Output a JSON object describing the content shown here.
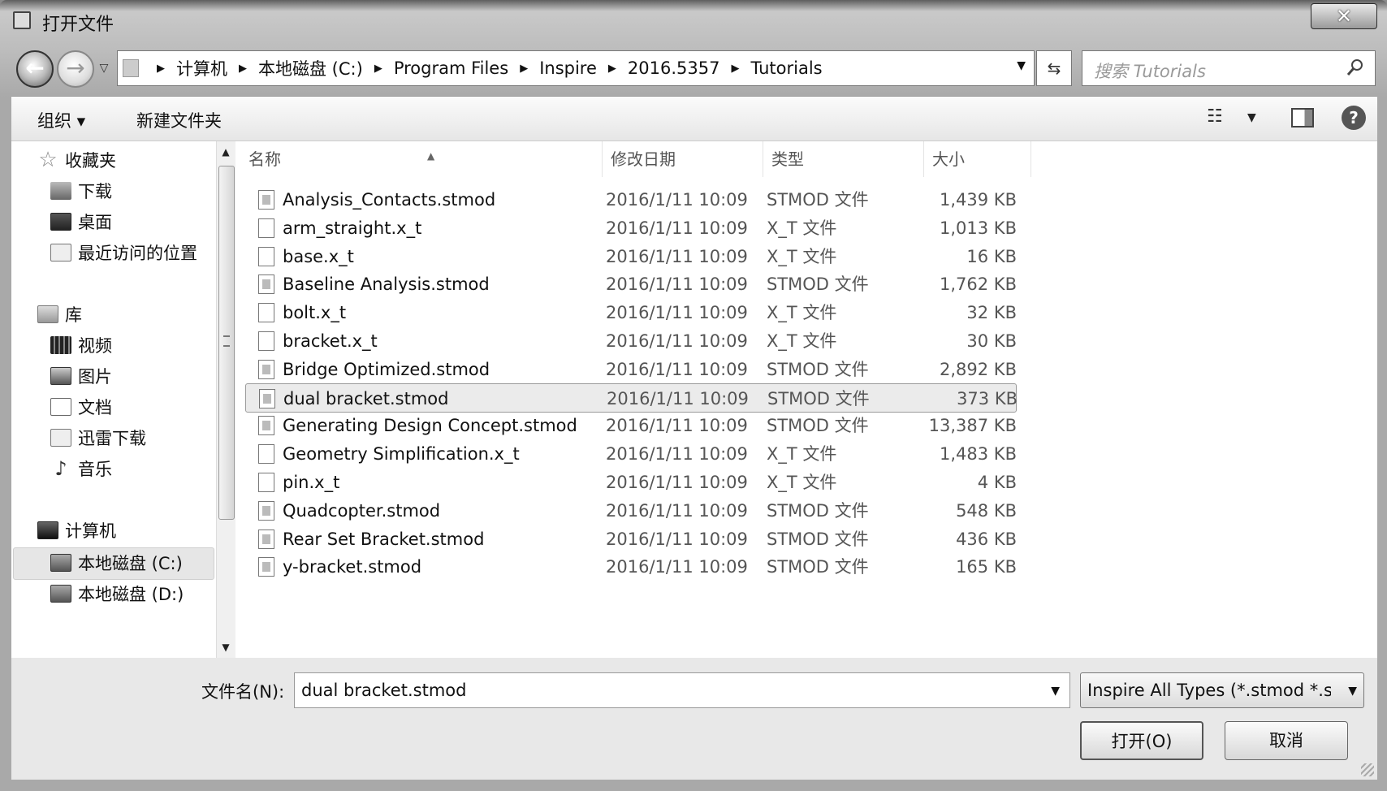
{
  "window": {
    "title": "打开文件",
    "close_glyph": "✕"
  },
  "nav": {
    "breadcrumbs": [
      "计算机",
      "本地磁盘 (C:)",
      "Program Files",
      "Inspire",
      "2016.5357",
      "Tutorials"
    ],
    "search_placeholder": "搜索 Tutorials"
  },
  "toolbar": {
    "organize": "组织 ▾",
    "new_folder": "新建文件夹"
  },
  "sidebar": {
    "favorites_label": "收藏夹",
    "favorites": [
      "下载",
      "桌面",
      "最近访问的位置"
    ],
    "libraries_label": "库",
    "libraries": [
      "视频",
      "图片",
      "文档",
      "迅雷下载",
      "音乐"
    ],
    "computer_label": "计算机",
    "drives": [
      "本地磁盘 (C:)",
      "本地磁盘 (D:)"
    ],
    "selected": "本地磁盘 (C:)"
  },
  "columns": {
    "name": "名称",
    "date": "修改日期",
    "type": "类型",
    "size": "大小"
  },
  "files": [
    {
      "name": "Analysis_Contacts.stmod",
      "date": "2016/1/11 10:09",
      "type": "STMOD 文件",
      "size": "1,439 KB",
      "kind": "stmod"
    },
    {
      "name": "arm_straight.x_t",
      "date": "2016/1/11 10:09",
      "type": "X_T 文件",
      "size": "1,013 KB",
      "kind": "xt"
    },
    {
      "name": "base.x_t",
      "date": "2016/1/11 10:09",
      "type": "X_T 文件",
      "size": "16 KB",
      "kind": "xt"
    },
    {
      "name": "Baseline Analysis.stmod",
      "date": "2016/1/11 10:09",
      "type": "STMOD 文件",
      "size": "1,762 KB",
      "kind": "stmod"
    },
    {
      "name": "bolt.x_t",
      "date": "2016/1/11 10:09",
      "type": "X_T 文件",
      "size": "32 KB",
      "kind": "xt"
    },
    {
      "name": "bracket.x_t",
      "date": "2016/1/11 10:09",
      "type": "X_T 文件",
      "size": "30 KB",
      "kind": "xt"
    },
    {
      "name": "Bridge Optimized.stmod",
      "date": "2016/1/11 10:09",
      "type": "STMOD 文件",
      "size": "2,892 KB",
      "kind": "stmod"
    },
    {
      "name": "dual bracket.stmod",
      "date": "2016/1/11 10:09",
      "type": "STMOD 文件",
      "size": "373 KB",
      "kind": "stmod",
      "selected": true
    },
    {
      "name": "Generating Design Concept.stmod",
      "date": "2016/1/11 10:09",
      "type": "STMOD 文件",
      "size": "13,387 KB",
      "kind": "stmod"
    },
    {
      "name": "Geometry Simplification.x_t",
      "date": "2016/1/11 10:09",
      "type": "X_T 文件",
      "size": "1,483 KB",
      "kind": "xt"
    },
    {
      "name": "pin.x_t",
      "date": "2016/1/11 10:09",
      "type": "X_T 文件",
      "size": "4 KB",
      "kind": "xt"
    },
    {
      "name": "Quadcopter.stmod",
      "date": "2016/1/11 10:09",
      "type": "STMOD 文件",
      "size": "548 KB",
      "kind": "stmod"
    },
    {
      "name": "Rear Set Bracket.stmod",
      "date": "2016/1/11 10:09",
      "type": "STMOD 文件",
      "size": "436 KB",
      "kind": "stmod"
    },
    {
      "name": "y-bracket.stmod",
      "date": "2016/1/11 10:09",
      "type": "STMOD 文件",
      "size": "165 KB",
      "kind": "stmod"
    }
  ],
  "footer": {
    "filename_label": "文件名(N):",
    "filename_value": "dual bracket.stmod",
    "filetype_value": "Inspire All Types (*.stmod *.s",
    "open_label": "打开(O)",
    "cancel_label": "取消"
  }
}
